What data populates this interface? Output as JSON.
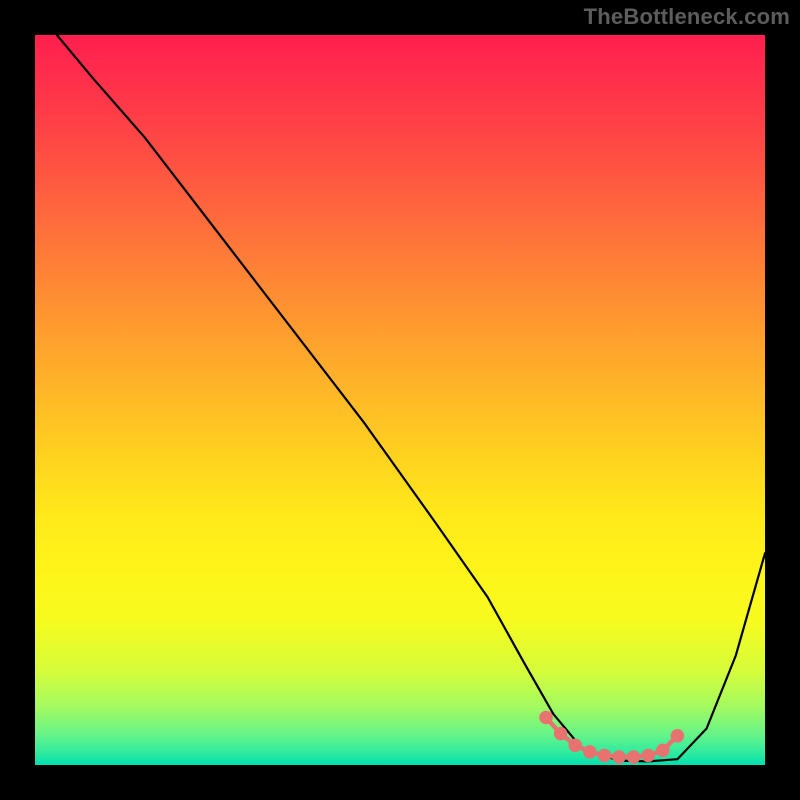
{
  "attribution": "TheBottleneck.com",
  "chart_data": {
    "type": "line",
    "title": "",
    "xlabel": "",
    "ylabel": "",
    "xlim": [
      0,
      100
    ],
    "ylim": [
      0,
      100
    ],
    "series": [
      {
        "name": "bottleneck-curve",
        "color": "#000000",
        "x": [
          3,
          8,
          15,
          25,
          35,
          45,
          55,
          62,
          67,
          71,
          75,
          80,
          84,
          88,
          92,
          96,
          100
        ],
        "y": [
          100,
          94,
          86,
          73,
          60,
          47,
          33,
          23,
          14,
          7,
          2.2,
          0.6,
          0.5,
          0.8,
          5,
          15,
          29
        ]
      },
      {
        "name": "optimal-band",
        "color": "#e8726f",
        "style": "dashed-markers",
        "x": [
          70,
          72,
          74,
          76,
          78,
          80,
          82,
          84,
          86,
          88
        ],
        "y": [
          6.5,
          4.3,
          2.7,
          1.8,
          1.3,
          1.1,
          1.1,
          1.3,
          2.0,
          4.0
        ]
      }
    ],
    "gradient_stops": [
      {
        "pos": 0,
        "color": "#ff1f4f"
      },
      {
        "pos": 50,
        "color": "#ffd31f"
      },
      {
        "pos": 75,
        "color": "#fff419"
      },
      {
        "pos": 100,
        "color": "#00dfb0"
      }
    ]
  }
}
